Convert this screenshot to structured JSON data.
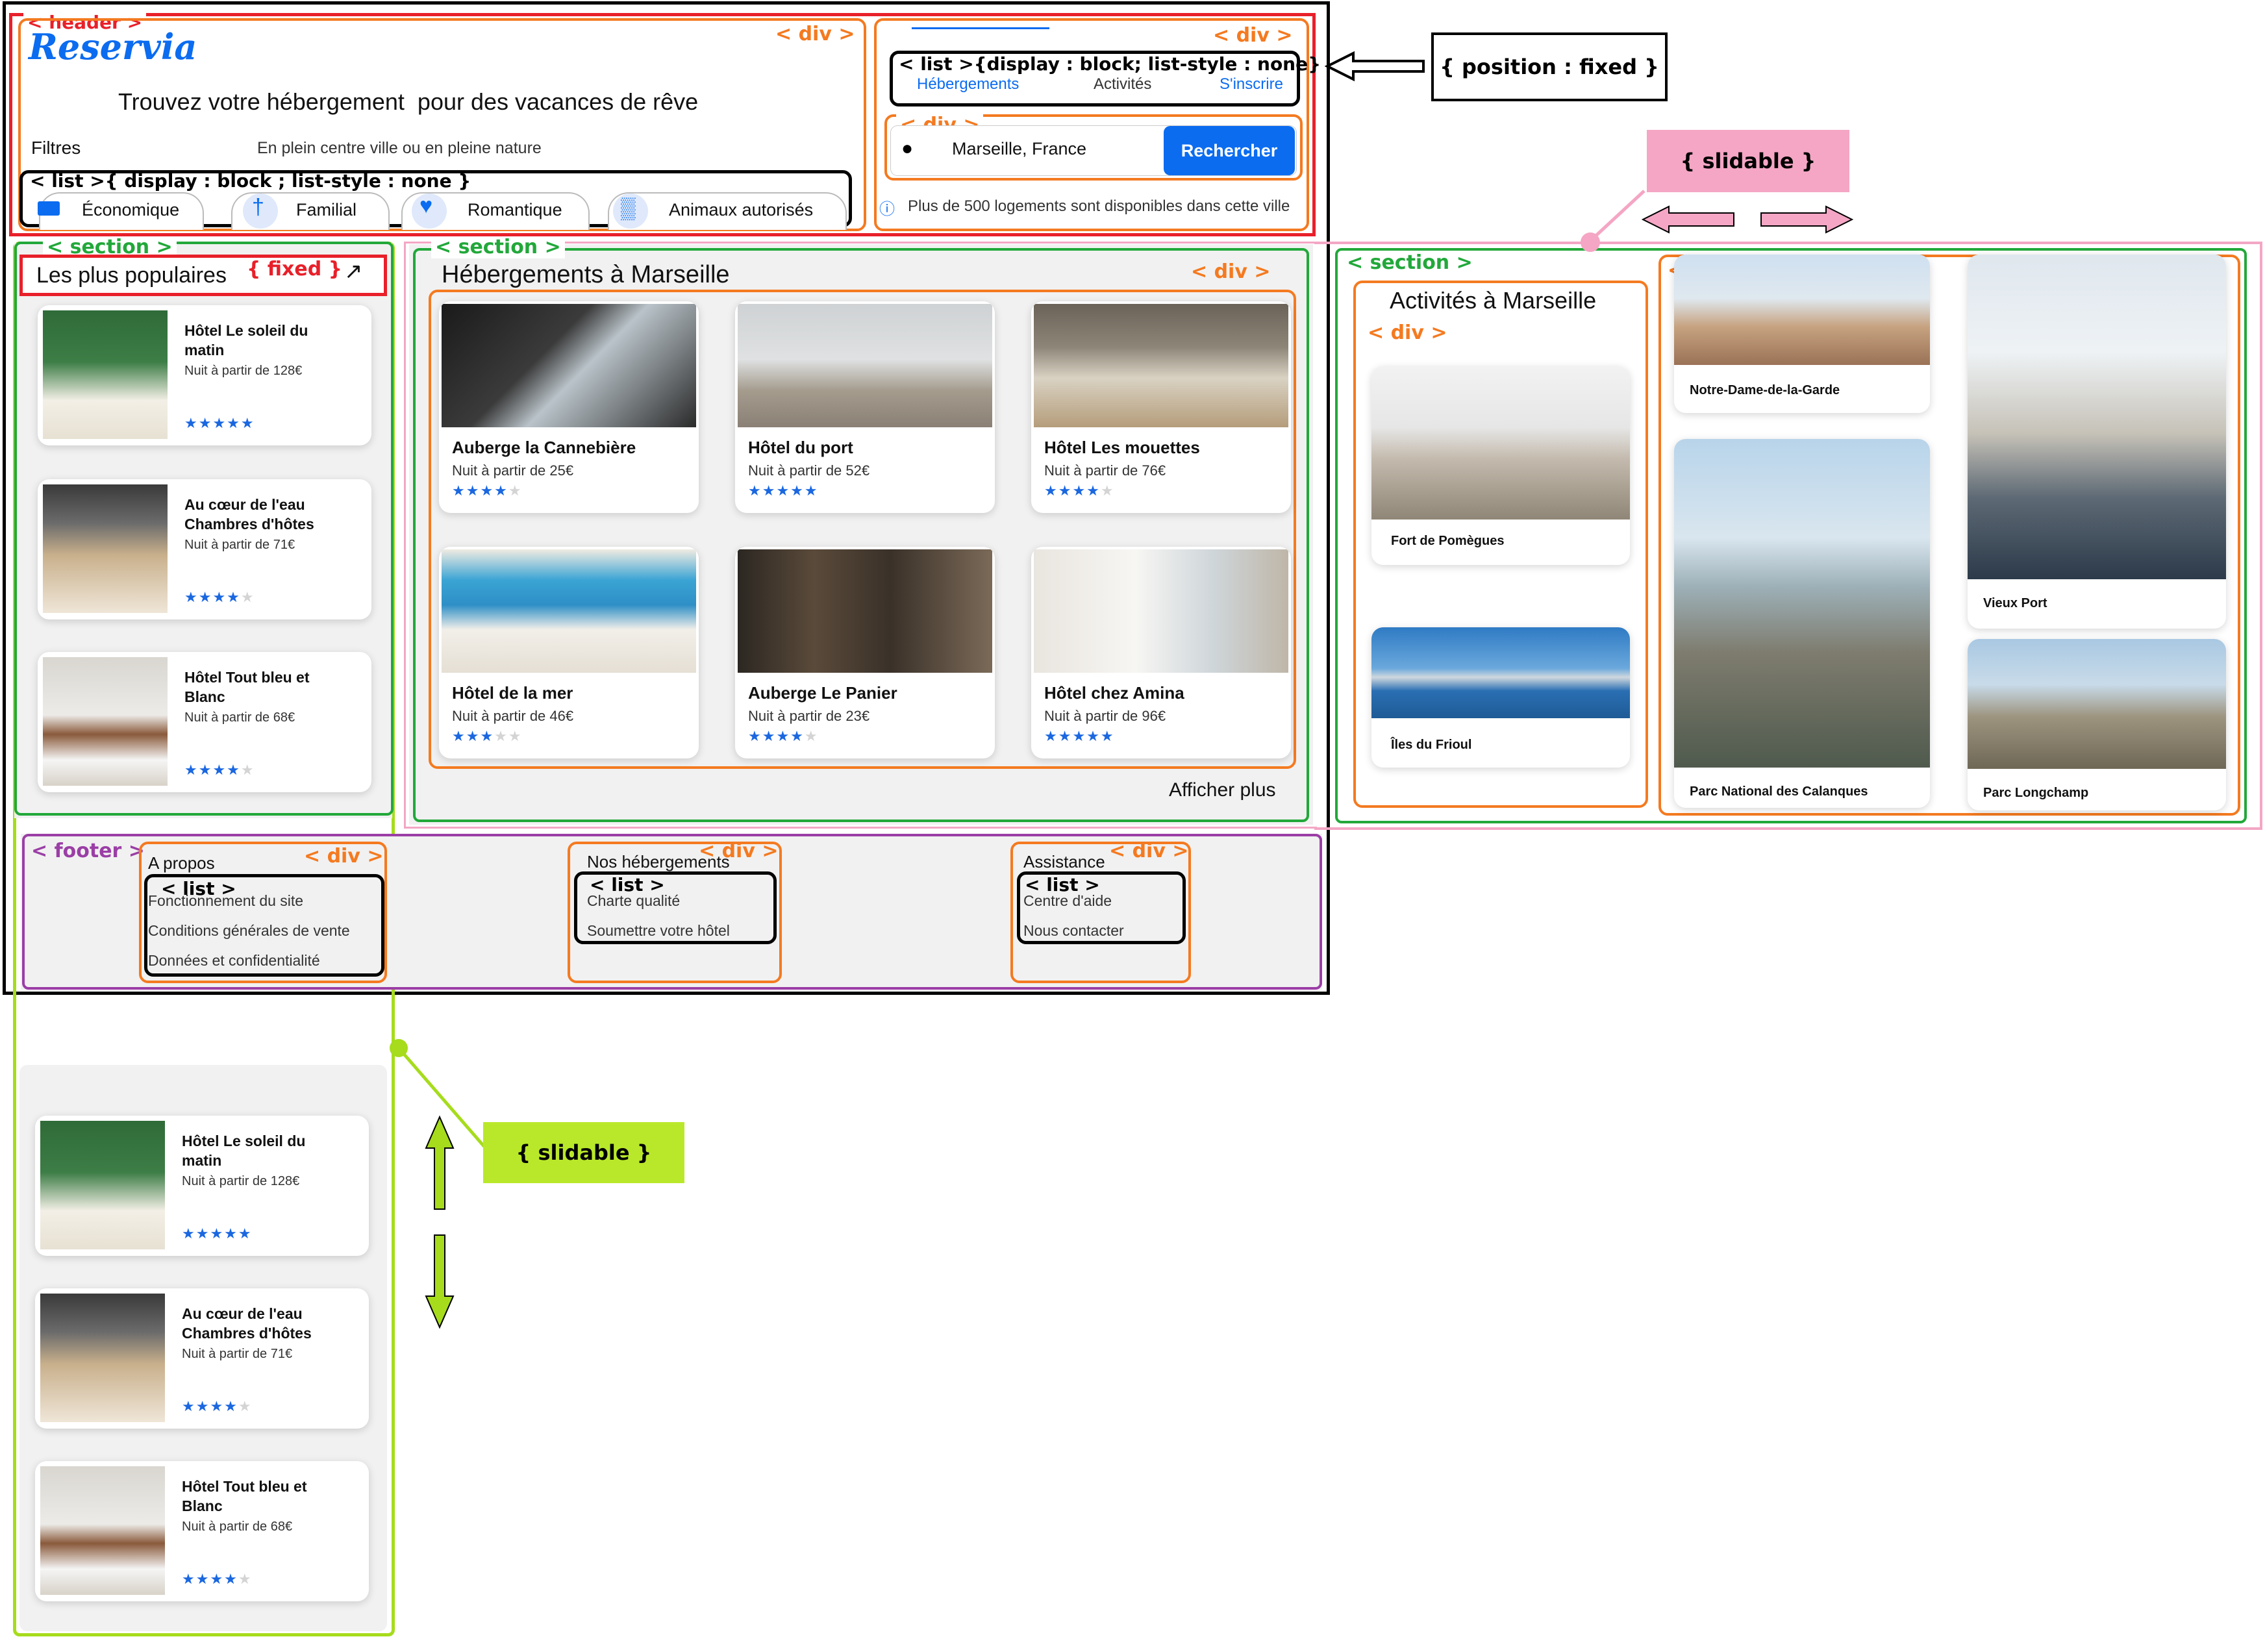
{
  "tags": {
    "header": "< header >",
    "div": "< div >",
    "list": "< list >",
    "section": "< section >",
    "footer": "< footer >",
    "fixed": "{ fixed }",
    "position_fixed": "{ position : fixed }",
    "slidable": "{ slidable }",
    "list_block": "< list >{ display : block ; list-style : none }",
    "list_block_nav": "< list >{display : block; list-style : none}"
  },
  "header": {
    "logo": "Reservia",
    "tagline_a": "Trouvez votre hébergement",
    "tagline_b": "pour des vacances de rêve",
    "filters_label": "Filtres",
    "filters_subtitle": "En plein centre ville ou en pleine nature",
    "filters": [
      "Économique",
      "Familial",
      "Romantique",
      "Animaux autorisés"
    ],
    "nav": [
      "Hébergements",
      "Activités",
      "S'inscrire"
    ],
    "search_value": "Marseille, France",
    "search_button": "Rechercher",
    "info": "Plus de 500 logements sont disponibles dans cette ville"
  },
  "popular": {
    "title": "Les plus populaires",
    "items": [
      {
        "name_1": "Hôtel Le soleil du",
        "name_2": "matin",
        "price": "Nuit à partir de 128€",
        "stars": 5
      },
      {
        "name_1": "Au cœur de l'eau",
        "name_2": "Chambres d'hôtes",
        "price": "Nuit à partir de 71€",
        "stars": 4
      },
      {
        "name_1": "Hôtel Tout bleu et",
        "name_2": "Blanc",
        "price": "Nuit à partir de 68€",
        "stars": 4
      }
    ]
  },
  "lodging": {
    "title": "Hébergements à Marseille",
    "more": "Afficher plus",
    "items": [
      {
        "name": "Auberge la Cannebière",
        "price": "Nuit à partir de 25€",
        "stars": 4
      },
      {
        "name": "Hôtel du port",
        "price": "Nuit à partir de 52€",
        "stars": 5
      },
      {
        "name": "Hôtel Les mouettes",
        "price": "Nuit à partir de 76€",
        "stars": 4
      },
      {
        "name": "Hôtel de la mer",
        "price": "Nuit à partir de 46€",
        "stars": 3
      },
      {
        "name": "Auberge Le Panier",
        "price": "Nuit à partir de 23€",
        "stars": 4
      },
      {
        "name": "Hôtel chez Amina",
        "price": "Nuit à partir de 96€",
        "stars": 5
      }
    ]
  },
  "activities": {
    "title": "Activités à Marseille",
    "items": [
      "Fort de Pomègues",
      "Îles du Frioul",
      "Notre-Dame-de-la-Garde",
      "Parc National des Calanques",
      "Vieux Port",
      "Parc Longchamp"
    ]
  },
  "footer": {
    "col1": {
      "title": "A propos",
      "links": [
        "Fonctionnement du site",
        "Conditions générales de vente",
        "Données et confidentialité"
      ]
    },
    "col2": {
      "title": "Nos hébergements",
      "links": [
        "Charte qualité",
        "Soumettre votre hôtel"
      ]
    },
    "col3": {
      "title": "Assistance",
      "links": [
        "Centre d'aide",
        "Nous contacter"
      ]
    }
  },
  "colors": {
    "accent": "#0b6cf0",
    "star": "#1a67e0",
    "header_tag": "#e8202a",
    "div_tag": "#f47a20",
    "section_tag": "#22a83a",
    "footer_tag": "#9b3ea6",
    "slidable_pink": "#f4a6c4",
    "slidable_lime": "#a6dc1c"
  }
}
